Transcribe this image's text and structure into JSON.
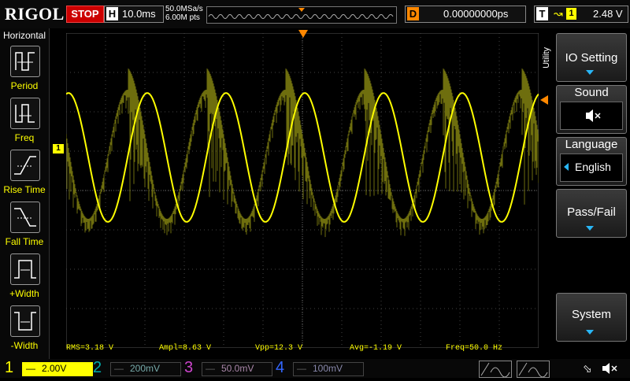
{
  "topbar": {
    "logo": "RIGOL",
    "run_state": "STOP",
    "horizontal_key": "H",
    "timebase": "10.0ms",
    "sample_rate": "50.0MSa/s",
    "memory_depth": "6.00M pts",
    "delay_key": "D",
    "delay_value": "0.00000000ps",
    "trigger_key": "T",
    "trigger_source": "1",
    "trigger_level": "2.48 V"
  },
  "left_panel": {
    "title": "Horizontal",
    "items": [
      {
        "label": "Period",
        "icon": "period-icon"
      },
      {
        "label": "Freq",
        "icon": "freq-icon"
      },
      {
        "label": "Rise Time",
        "icon": "rise-time-icon"
      },
      {
        "label": "Fall Time",
        "icon": "fall-time-icon"
      },
      {
        "label": "+Width",
        "icon": "pos-width-icon"
      },
      {
        "label": "-Width",
        "icon": "neg-width-icon"
      }
    ]
  },
  "right_menu": {
    "side_label": "Utility",
    "items": [
      {
        "label": "IO Setting"
      },
      {
        "label": "Sound",
        "value_icon": "speaker-mute-icon"
      },
      {
        "label": "Language",
        "value": "English"
      },
      {
        "label": "Pass/Fail"
      },
      {
        "label": "System"
      }
    ]
  },
  "measurements": {
    "rms": "RMS=3.18 V",
    "ampl": "Ampl=8.63 V",
    "vpp": "Vpp=12.3 V",
    "avg": "Avg=-1.19 V",
    "freq": "Freq=50.0 Hz"
  },
  "channels": [
    {
      "num": "1",
      "scale": "2.00V",
      "color": "#ffff00",
      "active": true
    },
    {
      "num": "2",
      "scale": "200mV",
      "color": "#00c0c0",
      "active": false
    },
    {
      "num": "3",
      "scale": "50.0mV",
      "color": "#e040e0",
      "active": false
    },
    {
      "num": "4",
      "scale": "100mV",
      "color": "#3080ff",
      "active": false
    }
  ],
  "marker_ch1": "1",
  "colors": {
    "ch1": "#ffff00",
    "accent": "#29b6f6",
    "trigger": "#ff8800",
    "stop": "#cc0000"
  }
}
